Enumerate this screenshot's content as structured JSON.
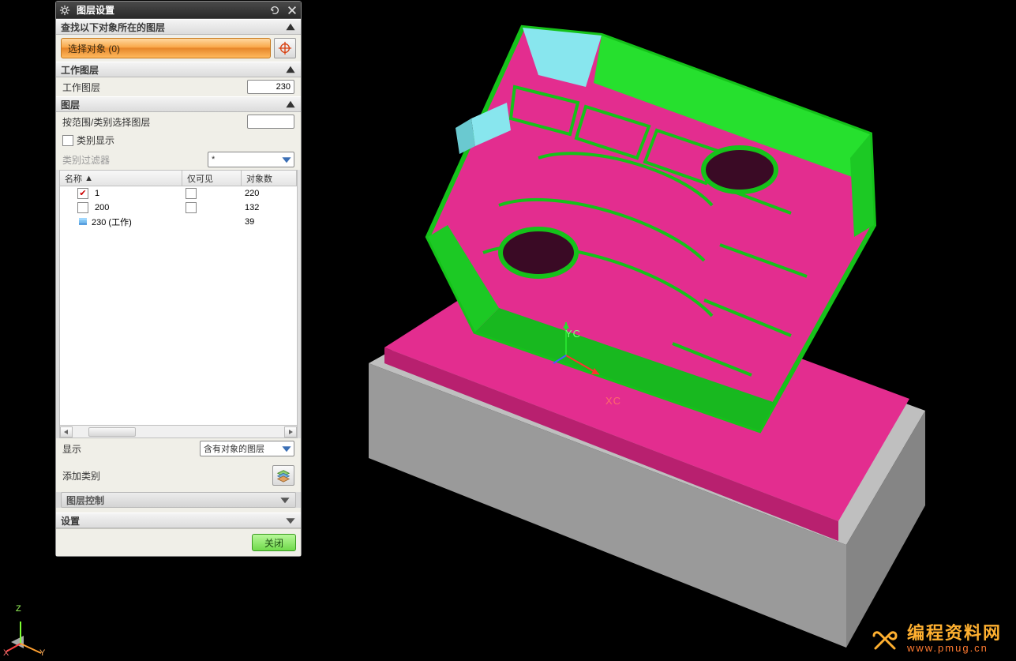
{
  "panel": {
    "title": "图层设置",
    "section_find": "查找以下对象所在的图层",
    "select_object": "选择对象 (0)",
    "section_work": "工作图层",
    "work_layer_label": "工作图层",
    "work_layer_value": "230",
    "section_layers": "图层",
    "range_label": "按范围/类别选择图层",
    "range_value": "",
    "cat_display": "类别显示",
    "cat_filter_label": "类别过滤器",
    "cat_filter_value": "*",
    "columns": {
      "name": "名称",
      "visible": "仅可见",
      "count": "对象数"
    },
    "rows": [
      {
        "name": "1",
        "checked": true,
        "vis_checked": false,
        "count": "220",
        "icon": "checkbox"
      },
      {
        "name": "200",
        "checked": false,
        "vis_checked": false,
        "count": "132",
        "icon": "checkbox"
      },
      {
        "name": "230 (工作)",
        "checked": false,
        "vis_checked": false,
        "count": "39",
        "icon": "stack"
      }
    ],
    "show_label": "显示",
    "show_value": "含有对象的图层",
    "add_category": "添加类别",
    "layer_control": "图层控制",
    "settings": "设置",
    "close": "关闭"
  },
  "viewport": {
    "axis_x": "XC",
    "axis_y": "YC",
    "triad": {
      "x": "X",
      "y": "Y",
      "z": "Z"
    }
  },
  "watermark": {
    "line1": "编程资料网",
    "line2": "www.pmug.cn"
  }
}
